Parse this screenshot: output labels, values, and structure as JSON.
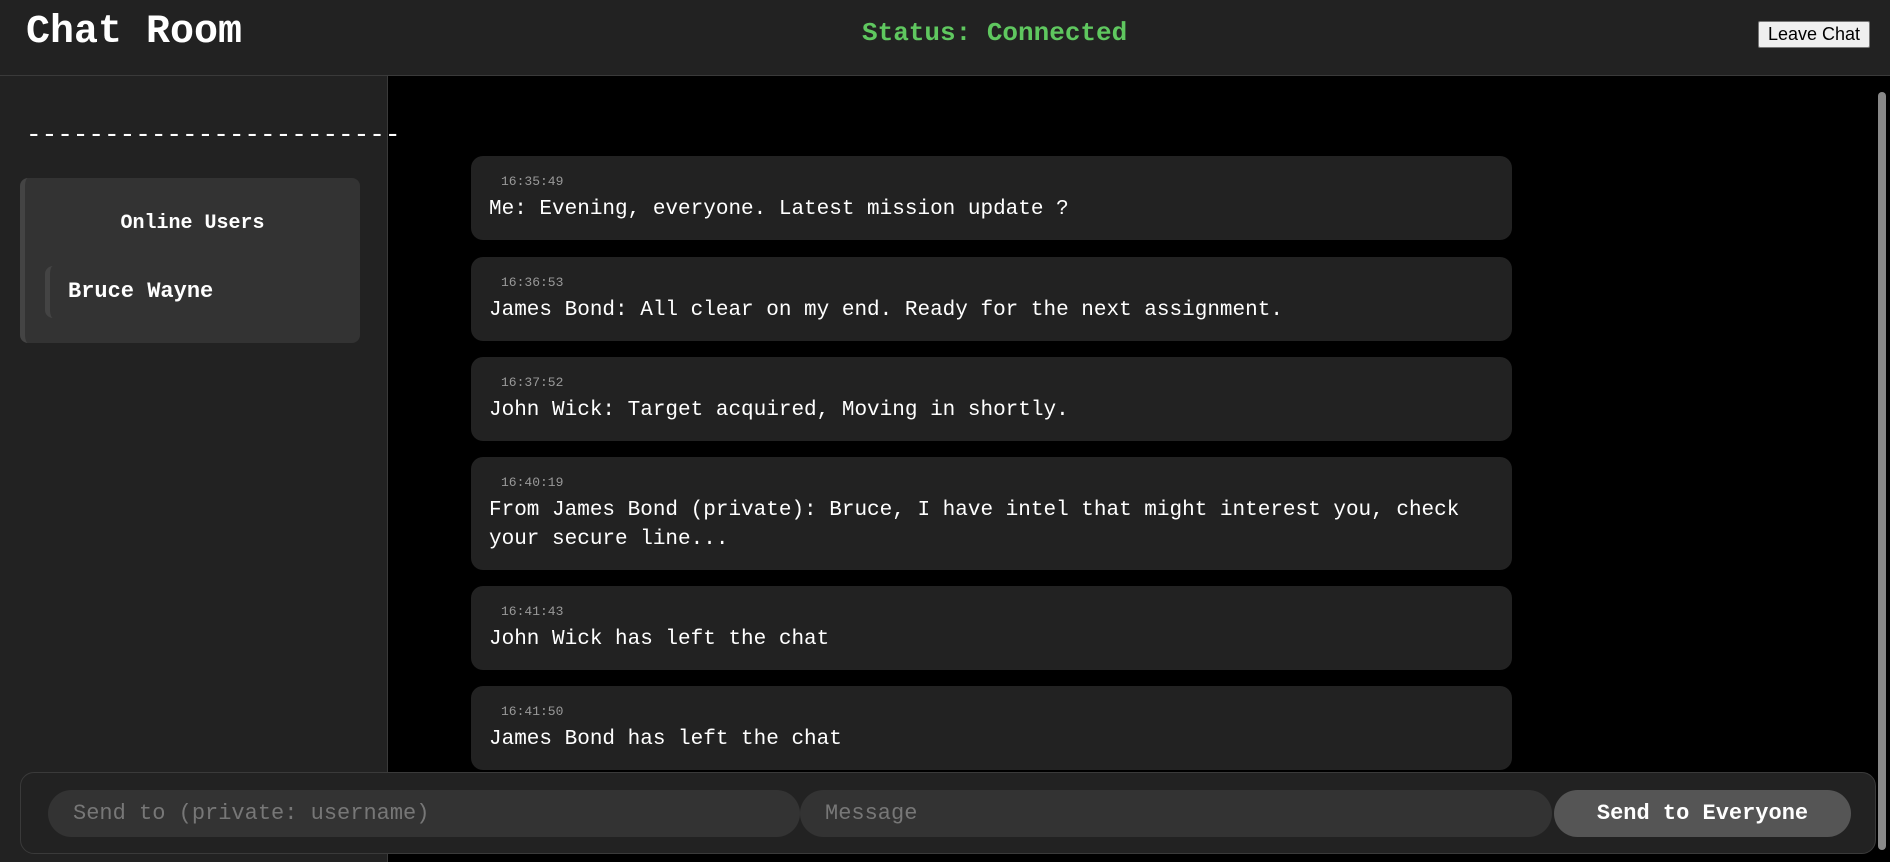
{
  "header": {
    "title": "Chat Room",
    "status": "Status: Connected",
    "leave_label": "Leave Chat"
  },
  "sidebar": {
    "divider": "------------------------",
    "users_heading": "Online Users",
    "users": [
      "Bruce Wayne"
    ]
  },
  "messages": [
    {
      "time": "16:35:49",
      "text": "Me: Evening, everyone. Latest mission update ?"
    },
    {
      "time": "16:36:53",
      "text": "James Bond: All clear on my end. Ready for the next assignment."
    },
    {
      "time": "16:37:52",
      "text": "John Wick: Target acquired, Moving in shortly."
    },
    {
      "time": "16:40:19",
      "text": "From James Bond (private): Bruce, I have intel that might interest you, check your secure line..."
    },
    {
      "time": "16:41:43",
      "text": "John Wick has left the chat"
    },
    {
      "time": "16:41:50",
      "text": "James Bond has left the chat"
    }
  ],
  "composer": {
    "recipient_placeholder": "Send to (private: username)",
    "recipient_value": "",
    "message_placeholder": "Message",
    "message_value": "",
    "send_label": "Send to Everyone"
  },
  "colors": {
    "status_connected": "#5fc75f",
    "background": "#000000",
    "panel": "#222222"
  }
}
